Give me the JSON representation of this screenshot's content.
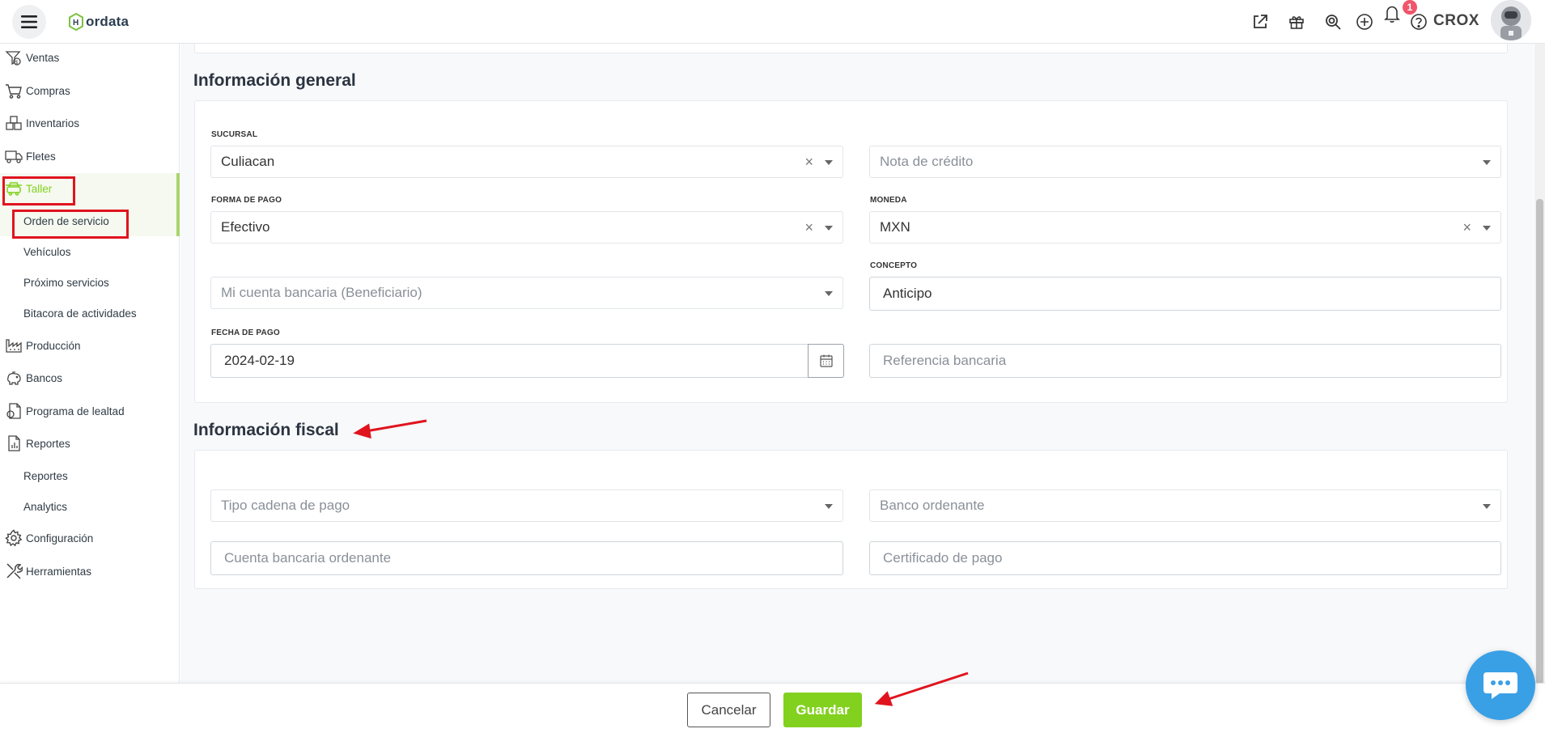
{
  "app": {
    "logo_text": "ordata",
    "user_name": "CROX",
    "notification_count": "1"
  },
  "sidebar": {
    "items": [
      {
        "label": "Ventas"
      },
      {
        "label": "Compras"
      },
      {
        "label": "Inventarios"
      },
      {
        "label": "Fletes"
      },
      {
        "label": "Taller"
      },
      {
        "label": "Orden de servicio"
      },
      {
        "label": "Vehículos"
      },
      {
        "label": "Próximo servicios"
      },
      {
        "label": "Bitacora de actividades"
      },
      {
        "label": "Producción"
      },
      {
        "label": "Bancos"
      },
      {
        "label": "Programa de lealtad"
      },
      {
        "label": "Reportes"
      },
      {
        "label": "Reportes"
      },
      {
        "label": "Analytics"
      },
      {
        "label": "Configuración"
      },
      {
        "label": "Herramientas"
      }
    ]
  },
  "general": {
    "title": "Información general",
    "sucursal_label": "SUCURSAL",
    "sucursal_value": "Culiacan",
    "nota_credito_placeholder": "Nota de crédito",
    "forma_pago_label": "FORMA DE PAGO",
    "forma_pago_value": "Efectivo",
    "moneda_label": "MONEDA",
    "moneda_value": "MXN",
    "cuenta_placeholder": "Mi cuenta bancaria (Beneficiario)",
    "concepto_label": "CONCEPTO",
    "concepto_value": "Anticipo",
    "fecha_label": "FECHA DE PAGO",
    "fecha_value": "2024-02-19",
    "referencia_placeholder": "Referencia bancaria"
  },
  "fiscal": {
    "title": "Información fiscal",
    "tipo_cadena_placeholder": "Tipo cadena de pago",
    "banco_ordenante_placeholder": "Banco ordenante",
    "cuenta_ordenante_placeholder": "Cuenta bancaria ordenante",
    "certificado_placeholder": "Certificado de pago"
  },
  "footer": {
    "cancel_label": "Cancelar",
    "save_label": "Guardar"
  },
  "colors": {
    "accent": "#82d11e",
    "annotation": "#e0141e",
    "chat": "#3aa0e6"
  }
}
